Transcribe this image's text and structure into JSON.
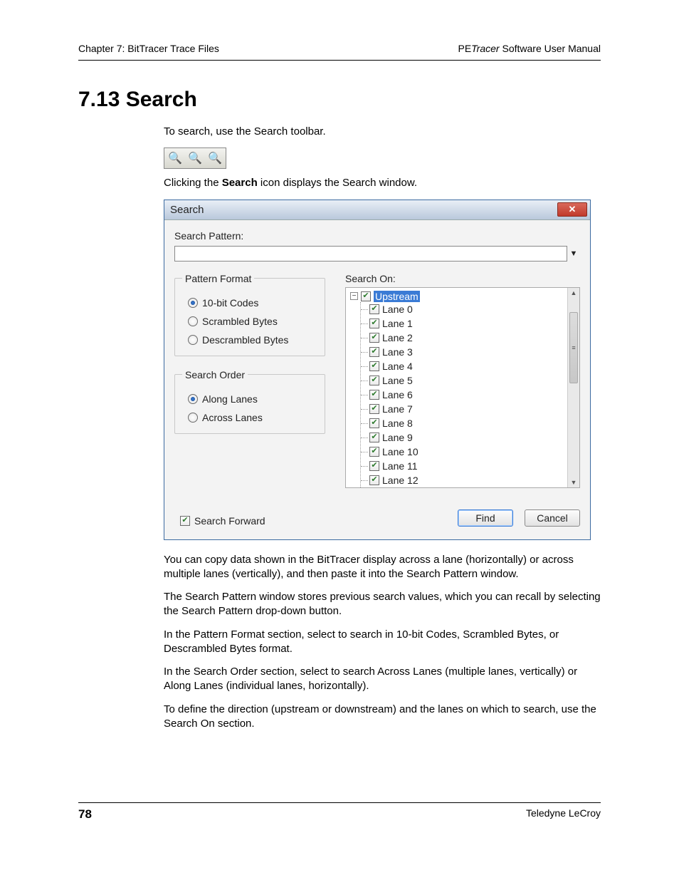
{
  "header": {
    "left": "Chapter 7: BitTracer Trace Files",
    "right_prefix": "PE",
    "right_italic": "Tracer",
    "right_suffix": " Software User Manual"
  },
  "section_title": "7.13 Search",
  "intro": {
    "p1": "To search, use the Search toolbar.",
    "p2_pre": "Clicking the ",
    "p2_bold": "Search",
    "p2_post": " icon displays the Search window."
  },
  "toolbar_icons": {
    "search": "🔍",
    "search_prev": "🔍",
    "search_next": "🔍"
  },
  "dialog": {
    "title": "Search",
    "close_label": "✕",
    "search_pattern_label": "Search Pattern:",
    "search_pattern_value": "",
    "pattern_format": {
      "legend": "Pattern Format",
      "options": [
        {
          "label": "10-bit Codes",
          "selected": true
        },
        {
          "label": "Scrambled Bytes",
          "selected": false
        },
        {
          "label": "Descrambled Bytes",
          "selected": false
        }
      ]
    },
    "search_order": {
      "legend": "Search Order",
      "options": [
        {
          "label": "Along Lanes",
          "selected": true
        },
        {
          "label": "Across Lanes",
          "selected": false
        }
      ]
    },
    "search_on": {
      "label": "Search On:",
      "root": "Upstream",
      "lanes": [
        "Lane 0",
        "Lane 1",
        "Lane 2",
        "Lane 3",
        "Lane 4",
        "Lane 5",
        "Lane 6",
        "Lane 7",
        "Lane 8",
        "Lane 9",
        "Lane 10",
        "Lane 11",
        "Lane 12"
      ],
      "expand_symbol": "−"
    },
    "search_forward_label": "Search Forward",
    "find_button": "Find",
    "cancel_button": "Cancel"
  },
  "body_paras": {
    "p3": "You can copy data shown in the BitTracer display across a lane (horizontally) or across multiple lanes (vertically), and then paste it into the Search Pattern window.",
    "p4": "The Search Pattern window stores previous search values, which you can recall by selecting the Search Pattern drop-down button.",
    "p5": "In the Pattern Format section, select to search in 10-bit Codes, Scrambled Bytes, or Descrambled Bytes format.",
    "p6": "In the Search Order section, select to search Across Lanes (multiple lanes, vertically) or Along Lanes (individual lanes, horizontally).",
    "p7": "To define the direction (upstream or downstream) and the lanes on which to search, use the Search On section."
  },
  "footer": {
    "page_number": "78",
    "vendor": "Teledyne LeCroy"
  }
}
